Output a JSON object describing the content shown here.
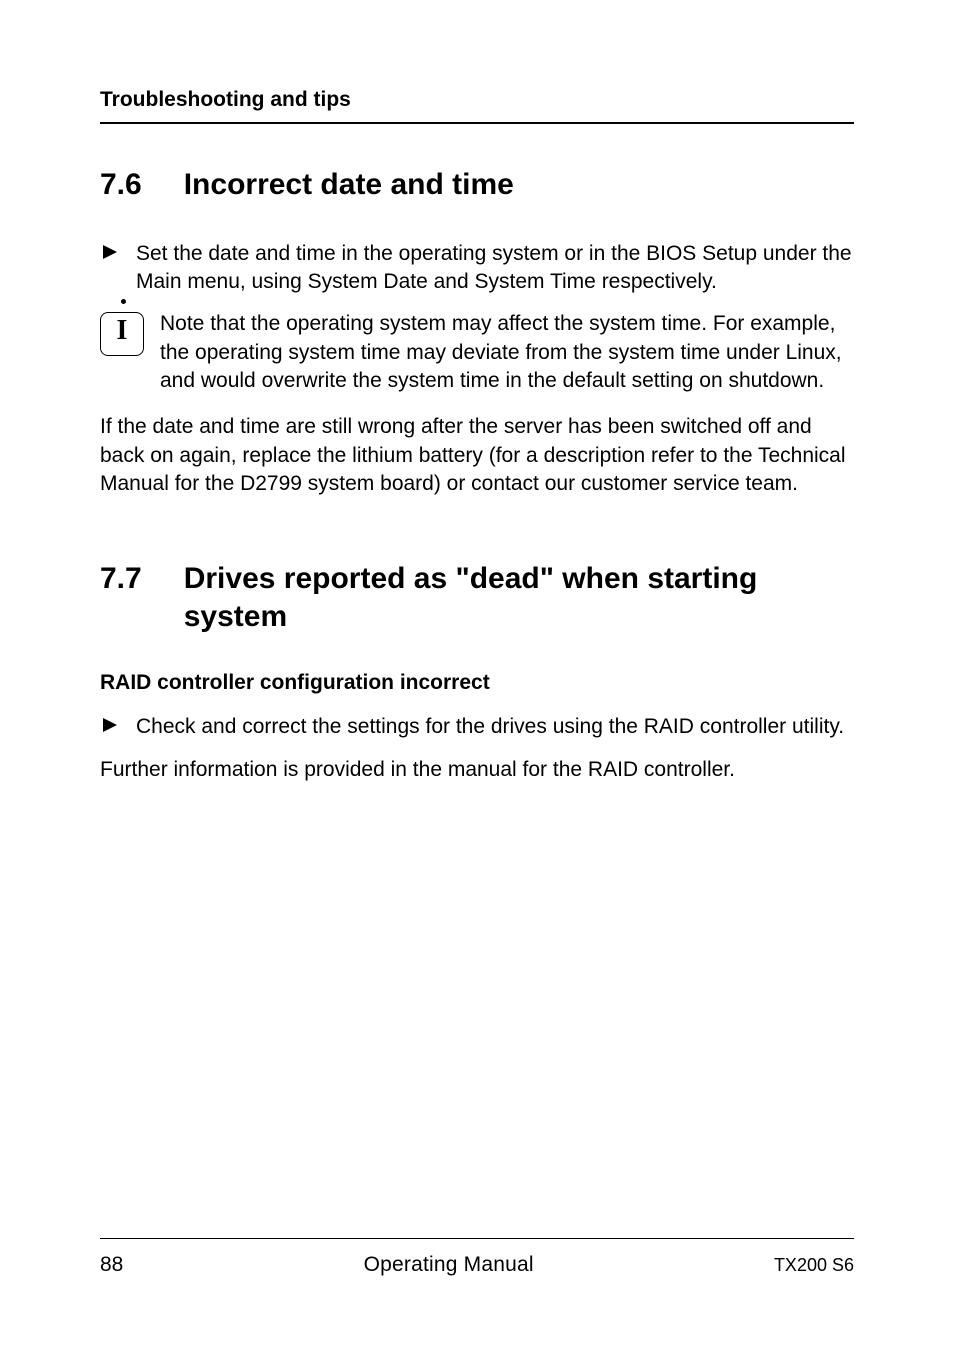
{
  "running_title": "Troubleshooting and tips",
  "sections": [
    {
      "number": "7.6",
      "title": "Incorrect date and time",
      "blocks": [
        {
          "type": "bullet",
          "text": "Set the date and time in the operating system or in the BIOS Setup under the Main menu, using System Date and System Time respectively."
        },
        {
          "type": "note",
          "icon_name": "info-icon",
          "text": "Note that the operating system may affect the system time. For example, the operating system time may deviate from the system time under Linux, and would overwrite the system time in the default setting on shutdown."
        },
        {
          "type": "para",
          "text": "If the date and time are still wrong after the server has been switched off and back on again, replace the lithium battery (for a description refer to the Technical Manual for the D2799 system board) or contact our customer service team."
        }
      ]
    },
    {
      "number": "7.7",
      "title": "Drives reported as \"dead\" when starting system",
      "blocks": [
        {
          "type": "subhead",
          "text": "RAID controller configuration incorrect"
        },
        {
          "type": "bullet",
          "text": "Check and correct the settings for the drives using the RAID controller utility."
        },
        {
          "type": "para",
          "text": "Further information is provided in the manual for the RAID controller."
        }
      ]
    }
  ],
  "footer": {
    "page_number": "88",
    "center": "Operating Manual",
    "right": "TX200 S6"
  }
}
